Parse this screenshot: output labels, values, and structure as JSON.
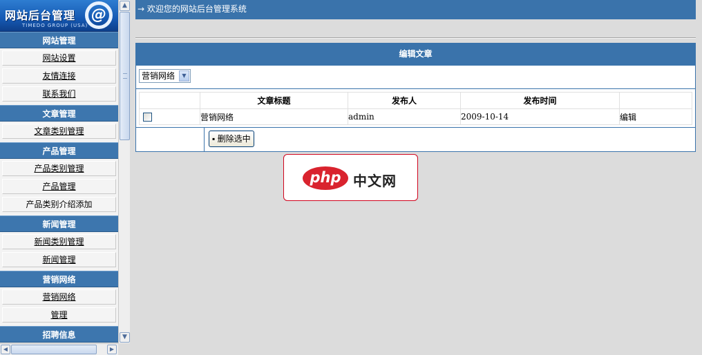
{
  "logo": {
    "title": "网站后台管理",
    "subtitle": "TIMEDO GROUP (USA)",
    "mark": "@"
  },
  "sidebar": {
    "sections": [
      {
        "title": "网站管理",
        "items": [
          "网站设置",
          "友情连接",
          "联系我们"
        ]
      },
      {
        "title": "文章管理",
        "items": [
          "文章类别管理"
        ]
      },
      {
        "title": "产品管理",
        "items": [
          "产品类别管理",
          "产品管理",
          "产品类别介绍添加"
        ]
      },
      {
        "title": "新闻管理",
        "items": [
          "新闻类别管理",
          "新闻管理"
        ]
      },
      {
        "title": "营销网络",
        "items": [
          "营销网络",
          "管理"
        ]
      },
      {
        "title": "招聘信息",
        "items": []
      }
    ]
  },
  "main": {
    "welcome": "→ 欢迎您的网站后台管理系统",
    "panel_title": "编辑文章",
    "category_select": {
      "value": "营销网络"
    },
    "table": {
      "columns": [
        "",
        "文章标题",
        "发布人",
        "发布时间",
        ""
      ],
      "rows": [
        {
          "title": "营销网络",
          "author": "admin",
          "date": "2009-10-14",
          "action": "编辑"
        }
      ]
    },
    "delete_button": "▪ 删除选中"
  },
  "watermark": {
    "oval_text": "php",
    "text": "中文网"
  },
  "colors": {
    "header_blue": "#3a73ab",
    "background": "#dcdcdc",
    "logo_red": "#d9232e"
  },
  "icons": [
    "arrow-right-icon",
    "chevron-down-icon",
    "scroll-up-icon",
    "scroll-down-icon",
    "scroll-left-icon",
    "scroll-right-icon"
  ]
}
